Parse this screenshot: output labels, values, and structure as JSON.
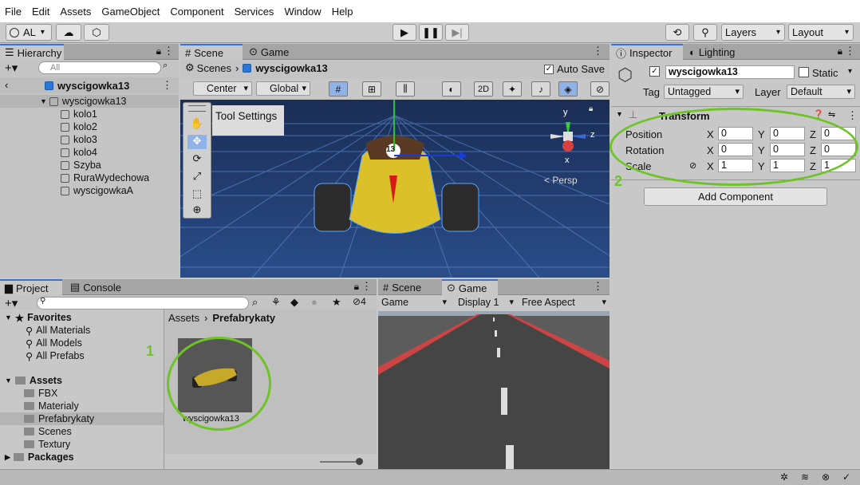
{
  "menu": [
    "File",
    "Edit",
    "Assets",
    "GameObject",
    "Component",
    "Services",
    "Window",
    "Help"
  ],
  "toolbar": {
    "account": "AL",
    "layers": "Layers",
    "layout": "Layout"
  },
  "hierarchy": {
    "tab": "Hierarchy",
    "search_placeholder": "All",
    "scene_root": "wyscigowka13",
    "items": [
      {
        "label": "wyscigowka13",
        "depth": 0
      },
      {
        "label": "kolo1",
        "depth": 1
      },
      {
        "label": "kolo2",
        "depth": 1
      },
      {
        "label": "kolo3",
        "depth": 1
      },
      {
        "label": "kolo4",
        "depth": 1
      },
      {
        "label": "Szyba",
        "depth": 1
      },
      {
        "label": "RuraWydechowa",
        "depth": 1
      },
      {
        "label": "wyscigowkaA",
        "depth": 1
      }
    ]
  },
  "scene": {
    "tab_scene": "Scene",
    "tab_game": "Game",
    "breadcrumb_scenes": "Scenes",
    "breadcrumb_object": "wyscigowka13",
    "auto_save": "Auto Save",
    "pivot": "Center",
    "space": "Global",
    "mode_2d": "2D",
    "tool_settings": "Tool Settings",
    "persp": "< Persp",
    "gizmo": {
      "y": "y",
      "x": "x",
      "z": "z"
    },
    "car_number": "13"
  },
  "project": {
    "tab_project": "Project",
    "tab_console": "Console",
    "hidden_count": "4",
    "favorites_label": "Favorites",
    "favorites": [
      "All Materials",
      "All Models",
      "All Prefabs"
    ],
    "assets_label": "Assets",
    "folders": [
      "FBX",
      "Materialy",
      "Prefabrykaty",
      "Scenes",
      "Textury"
    ],
    "packages_label": "Packages",
    "breadcrumb_root": "Assets",
    "breadcrumb_current": "Prefabrykaty",
    "asset_name": "wyscigowka13",
    "annotation": "1"
  },
  "game": {
    "tab_scene": "Scene",
    "tab_game": "Game",
    "mode": "Game",
    "display": "Display 1",
    "aspect": "Free Aspect"
  },
  "inspector": {
    "tab_inspector": "Inspector",
    "tab_lighting": "Lighting",
    "object_name": "wyscigowka13",
    "static_label": "Static",
    "tag_label": "Tag",
    "tag_value": "Untagged",
    "layer_label": "Layer",
    "layer_value": "Default",
    "component": "Transform",
    "rows": [
      {
        "label": "Position",
        "x": "0",
        "y": "0",
        "z": "0"
      },
      {
        "label": "Rotation",
        "x": "0",
        "y": "0",
        "z": "0"
      },
      {
        "label": "Scale",
        "x": "1",
        "y": "1",
        "z": "1"
      }
    ],
    "axis": {
      "x": "X",
      "y": "Y",
      "z": "Z"
    },
    "add_component": "Add Component",
    "annotation": "2"
  },
  "colors": {
    "accent": "#3a72d8",
    "annotation": "#6ec326",
    "scene_bg": "#213a6b"
  }
}
